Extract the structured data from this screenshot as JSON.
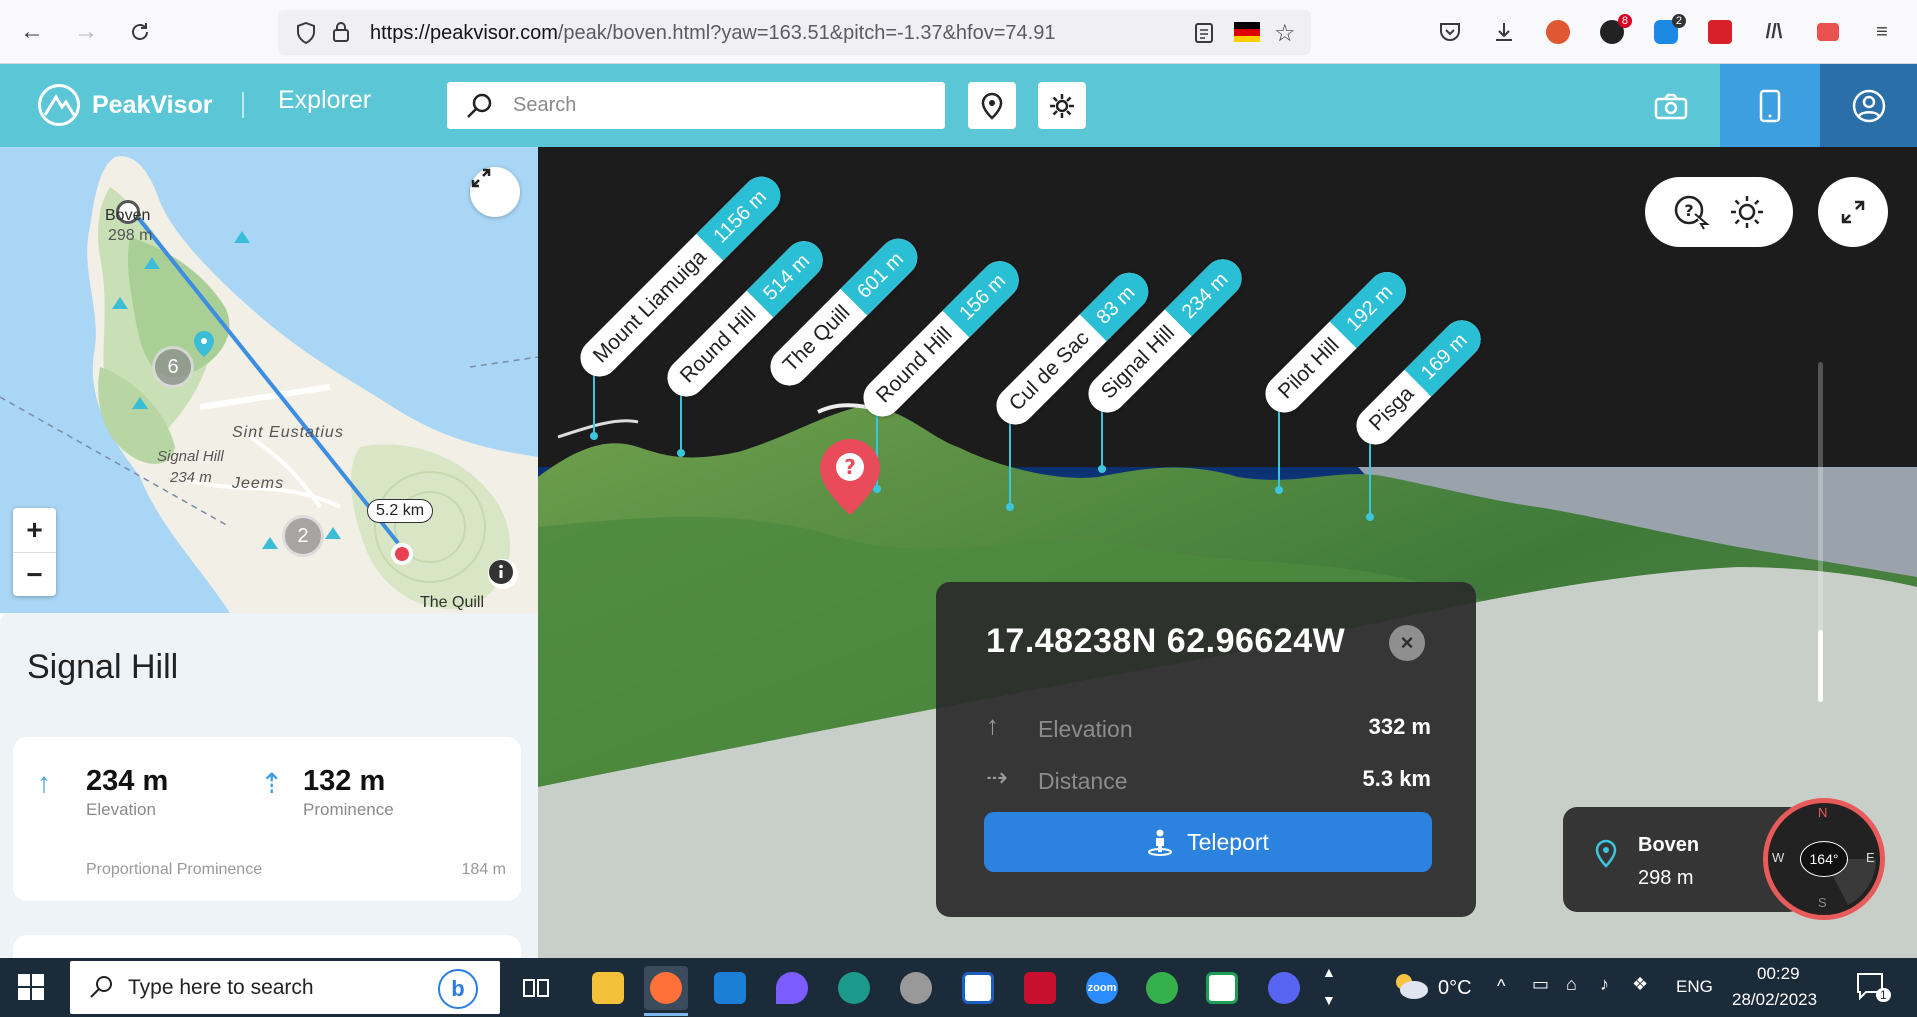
{
  "browser": {
    "url_host": "https://peakvisor.com",
    "url_path": "/peak/boven.html?yaw=163.51&pitch=-1.37&hfov=74.91",
    "badges": [
      "8",
      "2"
    ]
  },
  "header": {
    "brand": "PeakVisor",
    "explorer_label": "Explorer",
    "search_placeholder": "Search"
  },
  "map": {
    "labels": {
      "boven_name": "Boven",
      "boven_elev": "298 m",
      "sint_eustatius": "Sint Eustatius",
      "signal_hill_name": "Signal Hill",
      "signal_hill_elev": "234 m",
      "jeems": "Jeems",
      "the_quill": "The Quill"
    },
    "clusters": [
      "6",
      "2"
    ],
    "distance": "5.2 km",
    "zoom_in": "+",
    "zoom_out": "−"
  },
  "panel": {
    "title": "Signal Hill",
    "elevation_value": "234 m",
    "elevation_label": "Elevation",
    "prominence_value": "132 m",
    "prominence_label": "Prominence",
    "proportional_label": "Proportional Prominence",
    "proportional_value": "184 m"
  },
  "peaks": [
    {
      "name": "Mount Liamuiga",
      "elevation": "1156 m"
    },
    {
      "name": "Round Hill",
      "elevation": "514 m"
    },
    {
      "name": "The Quill",
      "elevation": "601 m"
    },
    {
      "name": "Round Hill",
      "elevation": "156 m"
    },
    {
      "name": "Cul de Sac",
      "elevation": "83 m"
    },
    {
      "name": "Signal Hill",
      "elevation": "234 m"
    },
    {
      "name": "Pilot Hill",
      "elevation": "192 m"
    },
    {
      "name": "Pisga",
      "elevation": "169 m"
    }
  ],
  "popup": {
    "coords": "17.48238N 62.96624W",
    "elevation_label": "Elevation",
    "elevation_value": "332 m",
    "distance_label": "Distance",
    "distance_value": "5.3 km",
    "teleport_label": "Teleport",
    "close": "×"
  },
  "viewpoint": {
    "name": "Boven",
    "elevation": "298 m",
    "heading": "164°",
    "dirs": {
      "n": "N",
      "e": "E",
      "s": "S",
      "w": "W"
    }
  },
  "taskbar": {
    "search_placeholder": "Type here to search",
    "bing_label": "b",
    "zoom_label": "zoom",
    "temperature": "0°C",
    "language": "ENG",
    "time": "00:29",
    "date": "28/02/2023",
    "notifications": "1"
  },
  "colors": {
    "peakvisor_teal": "#5bc7d6",
    "label_teal": "#2bbfd6",
    "teleport_blue": "#2c83df",
    "pin_red": "#e94b5a"
  }
}
